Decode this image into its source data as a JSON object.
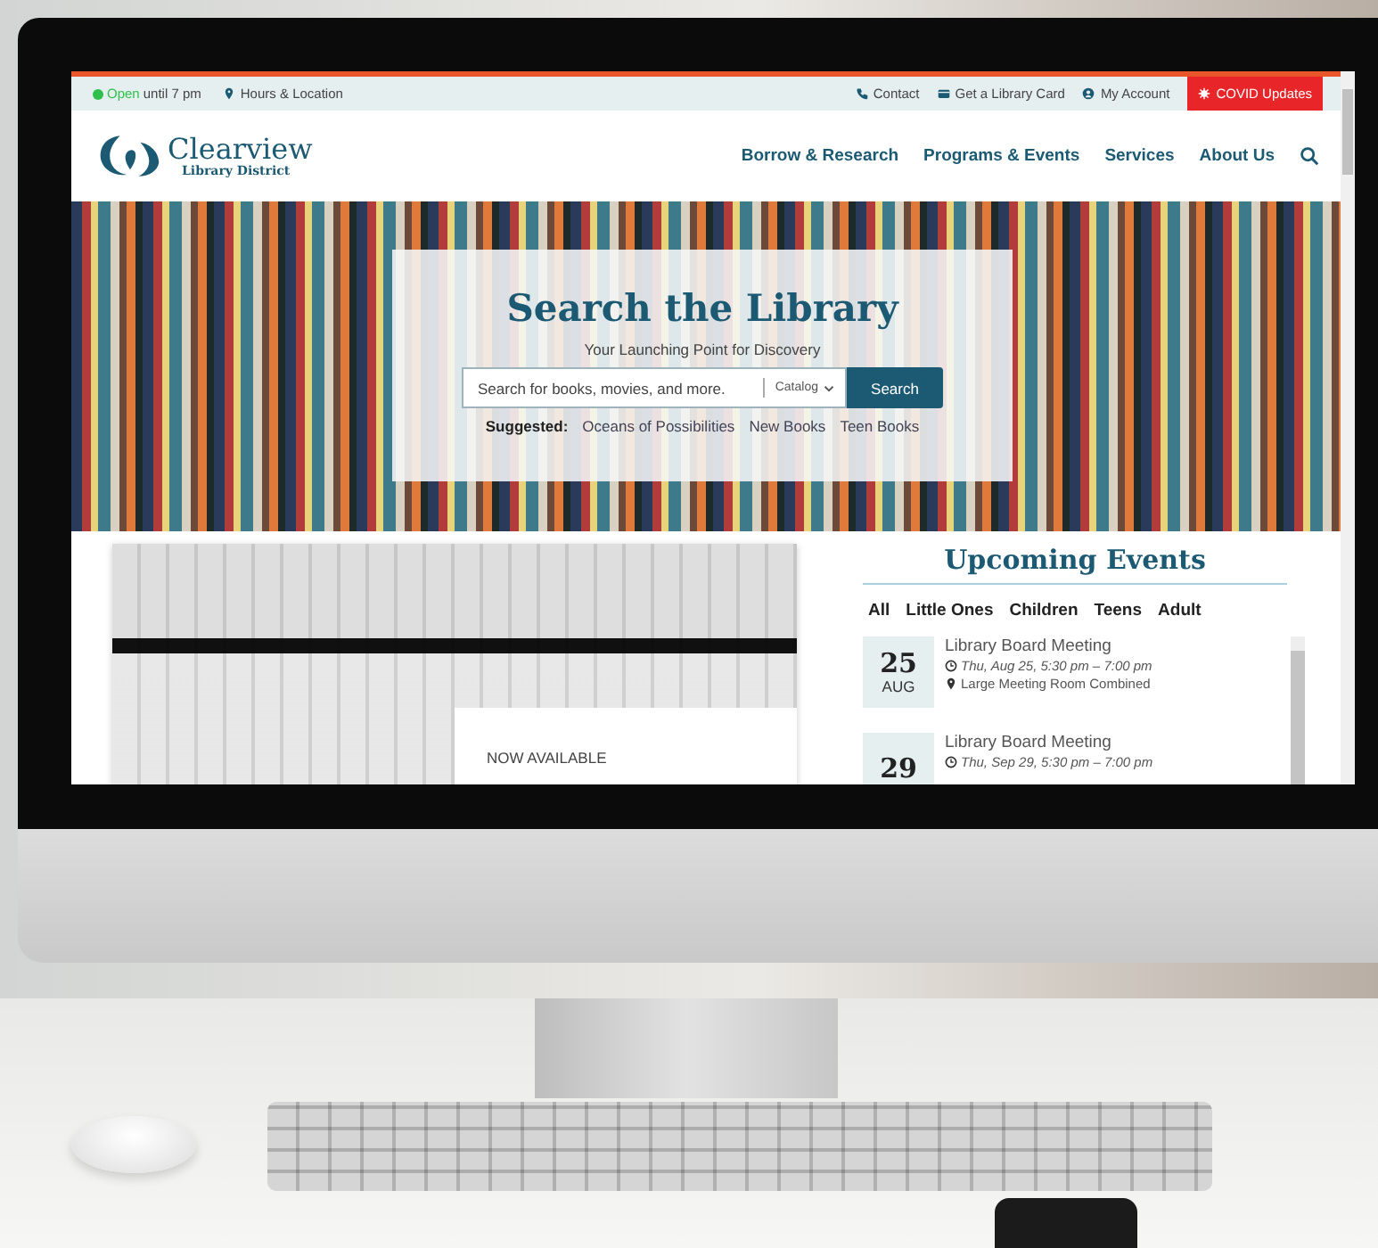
{
  "topbar": {
    "status": "Open",
    "status_note": "until 7 pm",
    "left_links": [
      {
        "label": "Hours & Location",
        "kind": "pin"
      }
    ],
    "right_links": [
      {
        "label": "Contact",
        "kind": "phone"
      },
      {
        "label": "Get a Library Card",
        "kind": "card"
      },
      {
        "label": "My Account",
        "kind": "user"
      }
    ],
    "alert": "COVID Updates"
  },
  "header": {
    "logo": {
      "name": "Clearview",
      "subtitle": "Library District"
    },
    "nav": [
      "Borrow & Research",
      "Programs & Events",
      "Services",
      "About Us"
    ]
  },
  "hero": {
    "title": "Search the Library",
    "subtitle": "Your Launching Point for Discovery",
    "search": {
      "placeholder": "Search for books, movies, and more.",
      "scope": "Catalog",
      "button": "Search"
    },
    "suggested_label": "Suggested:",
    "suggestions": [
      "Oceans of Possibilities",
      "New Books",
      "Teen Books"
    ]
  },
  "feature": {
    "caption": "NOW AVAILABLE"
  },
  "events": {
    "title": "Upcoming Events",
    "filters": [
      "All",
      "Little Ones",
      "Children",
      "Teens",
      "Adult"
    ],
    "items": [
      {
        "day": "25",
        "month": "AUG",
        "title": "Library Board Meeting",
        "when": "Thu, Aug 25, 5:30 pm – 7:00 pm",
        "where": "Large Meeting Room Combined"
      },
      {
        "day": "29",
        "title": "Library Board Meeting",
        "when": "Thu, Sep 29, 5:30 pm – 7:00 pm"
      }
    ]
  }
}
